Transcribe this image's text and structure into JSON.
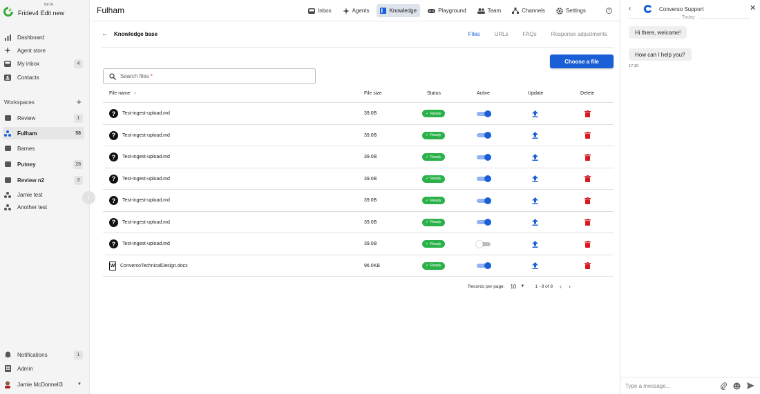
{
  "app": {
    "beta_badge": "BETA",
    "name": "Fridev4 Edit new"
  },
  "sidebar": {
    "items": [
      {
        "label": "Dashboard",
        "icon": "bar-chart-icon",
        "badge": ""
      },
      {
        "label": "Agent store",
        "icon": "sparkle-icon",
        "badge": ""
      },
      {
        "label": "My inbox",
        "icon": "inbox-icon",
        "badge": "4"
      },
      {
        "label": "Contacts",
        "icon": "contacts-icon",
        "badge": ""
      }
    ],
    "workspaces_label": "Workspaces",
    "add_symbol": "+",
    "workspaces": [
      {
        "label": "Review",
        "badge": "1"
      },
      {
        "label": "Fulham",
        "badge": "58"
      },
      {
        "label": "Barnes",
        "badge": ""
      },
      {
        "label": "Putney",
        "badge": "28"
      },
      {
        "label": "Review n2",
        "badge": "3"
      },
      {
        "label": "Jamie test",
        "badge": ""
      },
      {
        "label": "Another test",
        "badge": ""
      }
    ],
    "bottom": [
      {
        "label": "Notifications",
        "badge": "1"
      },
      {
        "label": "Admin",
        "badge": ""
      }
    ],
    "user": {
      "name": "Jamie McDonnell3"
    }
  },
  "header": {
    "title": "Fulham",
    "nav": [
      {
        "label": "Inbox",
        "icon": "inbox-icon"
      },
      {
        "label": "Agents",
        "icon": "sparkle-icon"
      },
      {
        "label": "Knowledge",
        "icon": "book-icon",
        "active": true
      },
      {
        "label": "Playground",
        "icon": "gamepad-icon"
      },
      {
        "label": "Team",
        "icon": "team-icon"
      },
      {
        "label": "Channels",
        "icon": "channels-icon"
      },
      {
        "label": "Settings",
        "icon": "gear-icon"
      }
    ],
    "help_symbol": "?"
  },
  "knowledge": {
    "title": "Knowledge base",
    "tabs": [
      "Files",
      "URLs",
      "FAQs",
      "Response adjustments"
    ],
    "choose_file_label": "Choose a file",
    "search_placeholder": "Search files",
    "search_required": "*",
    "columns": [
      "File name",
      "File size",
      "Status",
      "Active",
      "Update",
      "Delete"
    ],
    "sort_arrow": "↑",
    "rows": [
      {
        "name": "Test-ingest-upload.md",
        "type": "unknown",
        "size": "39.0B",
        "status": "Ready",
        "active": true
      },
      {
        "name": "Test-ingest-upload.md",
        "type": "unknown",
        "size": "39.0B",
        "status": "Ready",
        "active": true
      },
      {
        "name": "Test-ingest-upload.md",
        "type": "unknown",
        "size": "39.0B",
        "status": "Ready",
        "active": true
      },
      {
        "name": "Test-ingest-upload.md",
        "type": "unknown",
        "size": "39.0B",
        "status": "Ready",
        "active": true
      },
      {
        "name": "Test-ingest-upload.md",
        "type": "unknown",
        "size": "39.0B",
        "status": "Ready",
        "active": true
      },
      {
        "name": "Test-ingest-upload.md",
        "type": "unknown",
        "size": "39.0B",
        "status": "Ready",
        "active": true
      },
      {
        "name": "Test-ingest-upload.md",
        "type": "unknown",
        "size": "39.0B",
        "status": "Ready",
        "active": false
      },
      {
        "name": "ConversoTechnicalDesign.docx",
        "type": "word",
        "size": "96.0KB",
        "status": "Ready",
        "active": true
      }
    ],
    "pagination": {
      "records_label": "Records per page:",
      "per_page": "10",
      "range": "1 - 8 of 8"
    }
  },
  "chat": {
    "title": "Converso Support",
    "date_divider": "Today",
    "messages": [
      "Hi there, welcome!",
      "How can I help you?"
    ],
    "timestamp": "17:10",
    "input_placeholder": "Type a message..."
  },
  "colors": {
    "accent": "#1a5fd6",
    "ready": "#2bb14a",
    "delete": "#d71920",
    "logo_green": "#3aa83a"
  }
}
